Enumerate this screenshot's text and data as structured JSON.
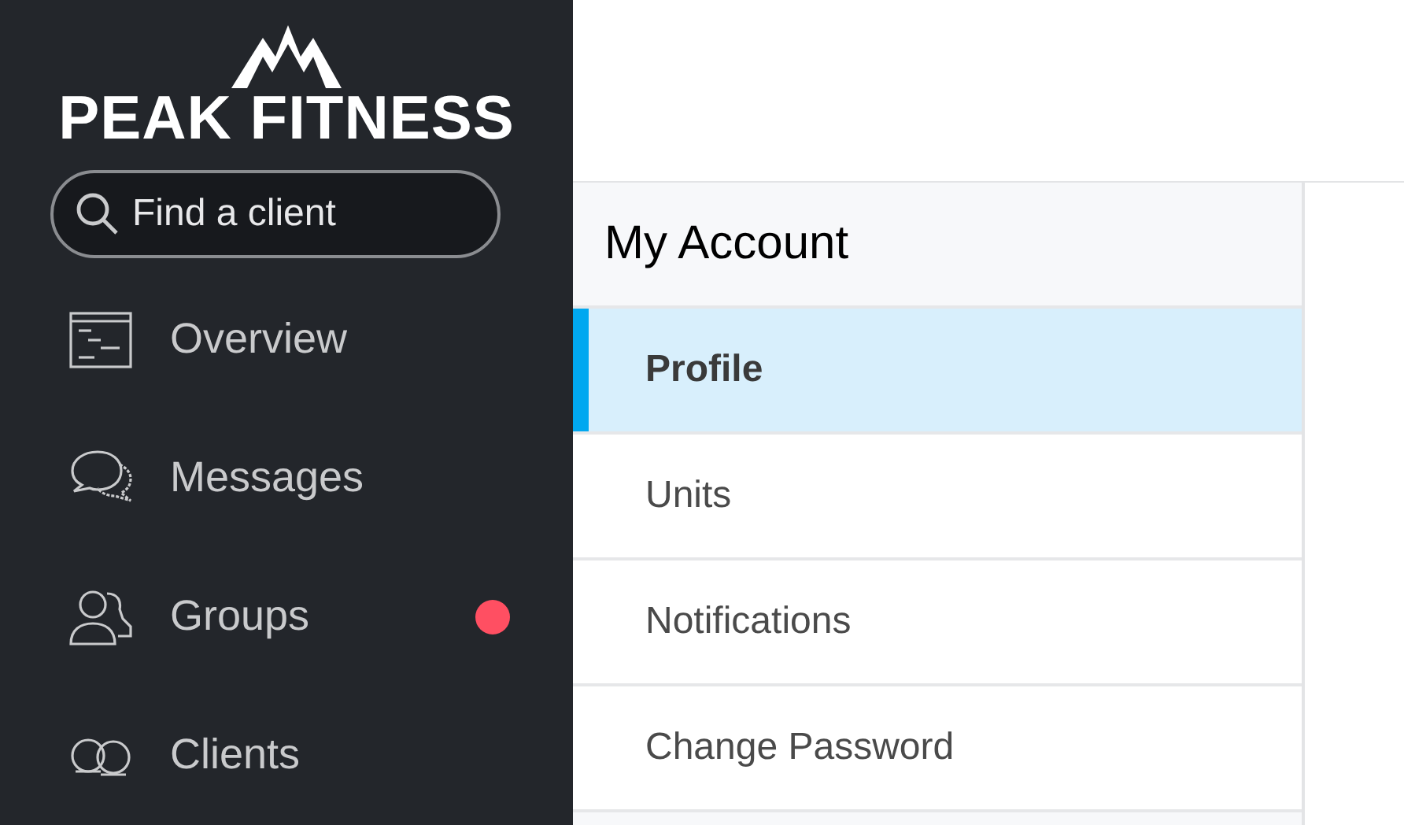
{
  "brand": {
    "name": "PEAK FITNESS"
  },
  "search": {
    "placeholder": "Find a client"
  },
  "sidebar": {
    "items": [
      {
        "kind": "overview",
        "label": "Overview",
        "alert": false
      },
      {
        "kind": "messages",
        "label": "Messages",
        "alert": false
      },
      {
        "kind": "groups",
        "label": "Groups",
        "alert": true
      },
      {
        "kind": "clients",
        "label": "Clients",
        "alert": false
      }
    ]
  },
  "account_menu": {
    "title": "My Account",
    "items": [
      {
        "label": "Profile",
        "selected": true
      },
      {
        "label": "Units",
        "selected": false
      },
      {
        "label": "Notifications",
        "selected": false
      },
      {
        "label": "Change Password",
        "selected": false
      }
    ]
  }
}
